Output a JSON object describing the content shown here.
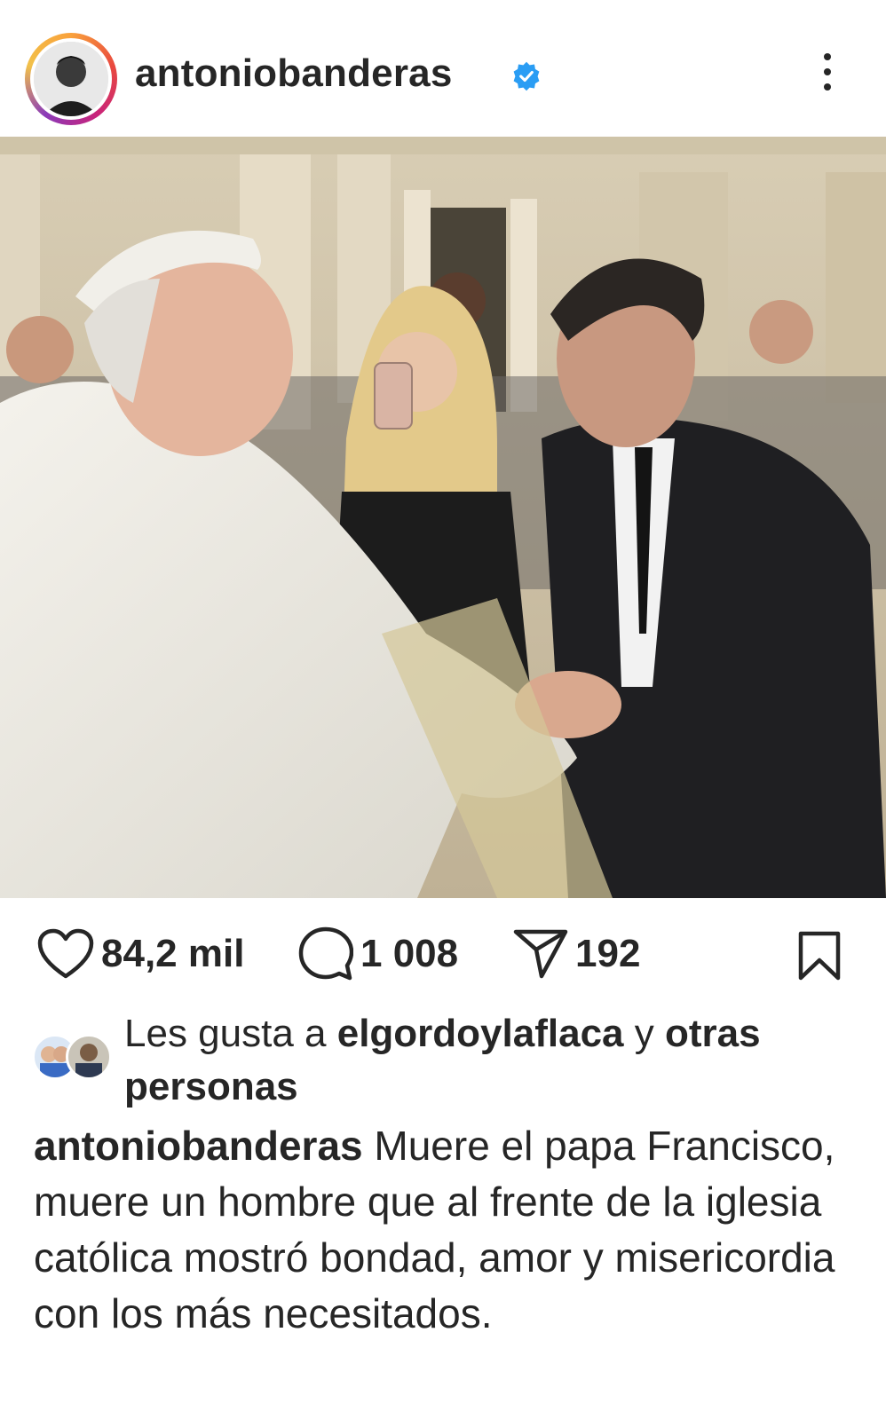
{
  "header": {
    "username": "antoniobanderas",
    "verified_icon": "verified-badge-icon",
    "more_icon": "more-vertical-icon"
  },
  "post": {
    "image_icon": "photo"
  },
  "actions": {
    "likes": "84,2 mil",
    "comments": "1 008",
    "shares": "192"
  },
  "liked_by": {
    "prefix": "Les gusta a ",
    "user": "elgordoylaflaca",
    "connector": " y ",
    "others": "otras personas"
  },
  "caption": {
    "username": "antoniobanderas",
    "text": " Muere el papa Francisco, muere un hombre que al frente de la iglesia católica mostró bondad, amor y misericordia con los más necesitados."
  },
  "colors": {
    "verified": "#2a9df4",
    "text": "#262626"
  }
}
